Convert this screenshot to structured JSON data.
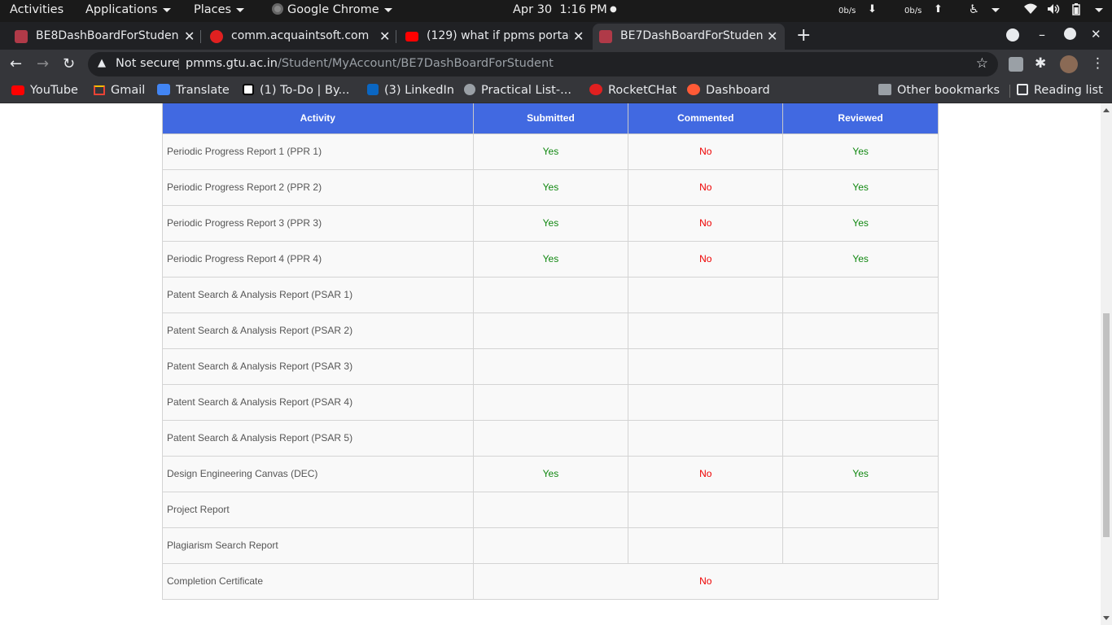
{
  "topbar": {
    "activities": "Activities",
    "applications": "Applications",
    "places": "Places",
    "app_name": "Google Chrome",
    "date": "Apr 30",
    "time": "1:16 PM",
    "net_down": "0b/s",
    "net_up": "0b/s"
  },
  "tabs": [
    {
      "title": "BE8DashBoardForStuden",
      "favicon_color": "#b03a48"
    },
    {
      "title": "comm.acquaintsoft.com",
      "favicon_color": "#e02020"
    },
    {
      "title": "(129) what if ppms portal",
      "favicon_color": "#ff0000"
    },
    {
      "title": "BE7DashBoardForStuden",
      "favicon_color": "#b03a48"
    }
  ],
  "omnibox": {
    "security": "Not secure",
    "url_host": "pmms.gtu.ac.in",
    "url_path": "/Student/MyAccount/BE7DashBoardForStudent"
  },
  "bookmarks": {
    "items": [
      {
        "label": "YouTube",
        "icon": "youtube-icon",
        "color": "#ff0000"
      },
      {
        "label": "Gmail",
        "icon": "gmail-icon",
        "color": "#ea4335"
      },
      {
        "label": "Translate",
        "icon": "translate-icon",
        "color": "#4285f4"
      },
      {
        "label": "(1) To-Do | By...",
        "icon": "notion-icon",
        "color": "#ffffff"
      },
      {
        "label": "(3) LinkedIn",
        "icon": "linkedin-icon",
        "color": "#0a66c2"
      },
      {
        "label": "Practical List-...",
        "icon": "globe-icon",
        "color": "#9aa0a6"
      },
      {
        "label": "RocketCHat",
        "icon": "rocketchat-icon",
        "color": "#e02020"
      },
      {
        "label": "Dashboard",
        "icon": "dashboard-icon",
        "color": "#ff5a36"
      }
    ],
    "other": "Other bookmarks",
    "reading_list": "Reading list"
  },
  "table": {
    "headers": [
      "Activity",
      "Submitted",
      "Commented",
      "Reviewed"
    ],
    "rows": [
      {
        "activity": "Periodic Progress Report 1 (PPR 1)",
        "submitted": "Yes",
        "commented": "No",
        "reviewed": "Yes"
      },
      {
        "activity": "Periodic Progress Report 2 (PPR 2)",
        "submitted": "Yes",
        "commented": "No",
        "reviewed": "Yes"
      },
      {
        "activity": "Periodic Progress Report 3 (PPR 3)",
        "submitted": "Yes",
        "commented": "No",
        "reviewed": "Yes"
      },
      {
        "activity": "Periodic Progress Report 4 (PPR 4)",
        "submitted": "Yes",
        "commented": "No",
        "reviewed": "Yes"
      },
      {
        "activity": "Patent Search & Analysis Report (PSAR 1)",
        "submitted": "",
        "commented": "",
        "reviewed": ""
      },
      {
        "activity": "Patent Search & Analysis Report (PSAR 2)",
        "submitted": "",
        "commented": "",
        "reviewed": ""
      },
      {
        "activity": "Patent Search & Analysis Report (PSAR 3)",
        "submitted": "",
        "commented": "",
        "reviewed": ""
      },
      {
        "activity": "Patent Search & Analysis Report (PSAR 4)",
        "submitted": "",
        "commented": "",
        "reviewed": ""
      },
      {
        "activity": "Patent Search & Analysis Report (PSAR 5)",
        "submitted": "",
        "commented": "",
        "reviewed": ""
      },
      {
        "activity": "Design Engineering Canvas (DEC)",
        "submitted": "Yes",
        "commented": "No",
        "reviewed": "Yes"
      },
      {
        "activity": "Project Report",
        "submitted": "",
        "commented": "",
        "reviewed": ""
      },
      {
        "activity": "Plagiarism Search Report",
        "submitted": "",
        "commented": "",
        "reviewed": ""
      }
    ],
    "completion": {
      "activity": "Completion Certificate",
      "status": "No"
    }
  },
  "colors": {
    "header_bg": "#4169e1",
    "yes": "#118811",
    "no": "#ee0000"
  }
}
